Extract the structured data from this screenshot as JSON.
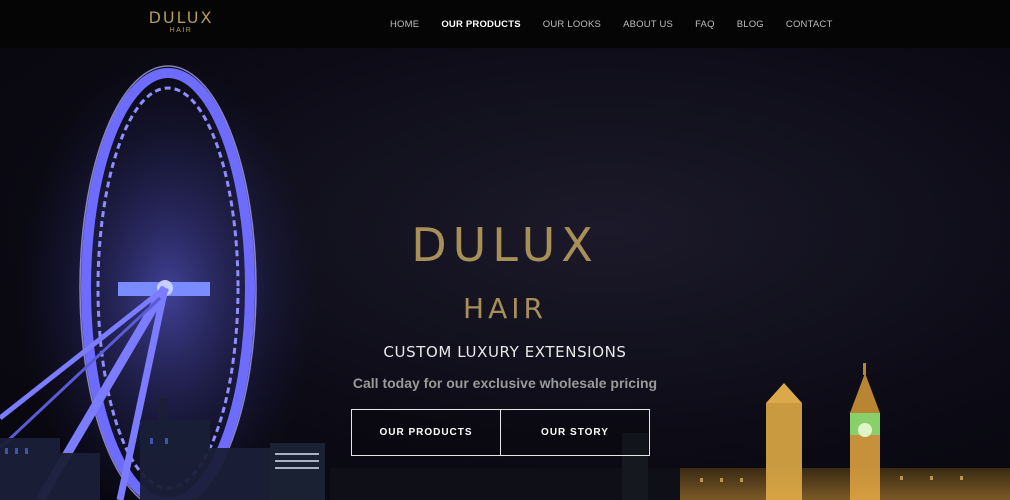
{
  "nav": {
    "logo_main": "DULUX",
    "logo_sub": "HAIR",
    "items": [
      {
        "label": "HOME",
        "active": false
      },
      {
        "label": "OUR PRODUCTS",
        "active": true
      },
      {
        "label": "OUR LOOKS",
        "active": false
      },
      {
        "label": "ABOUT US",
        "active": false
      },
      {
        "label": "FAQ",
        "active": false
      },
      {
        "label": "BLOG",
        "active": false
      },
      {
        "label": "CONTACT",
        "active": false
      }
    ]
  },
  "hero": {
    "title": "DULUX",
    "subtitle": "HAIR",
    "tagline": "CUSTOM LUXURY EXTENSIONS",
    "cta_text": "Call today for our exclusive wholesale pricing",
    "buttons": [
      {
        "label": "OUR PRODUCTS"
      },
      {
        "label": "OUR STORY"
      }
    ],
    "background_image": "london-eye-night-skyline"
  },
  "colors": {
    "brand_gold": "#a88f58",
    "nav_background": "#050505",
    "eye_glow": "#5b5cff"
  }
}
